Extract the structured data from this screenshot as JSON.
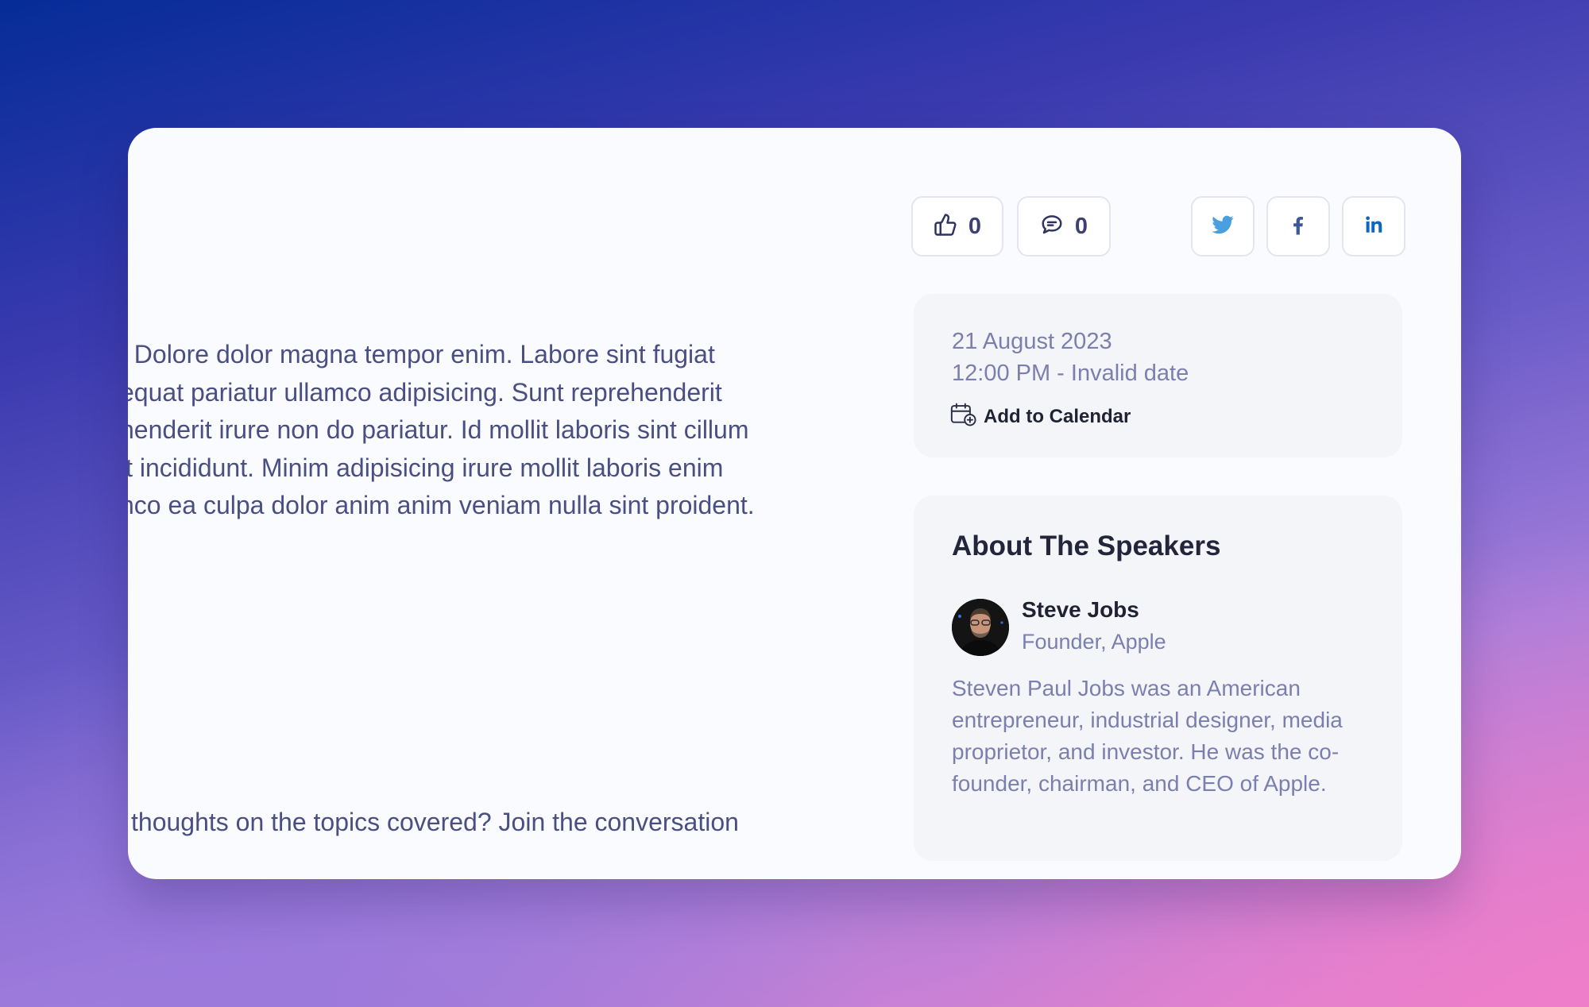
{
  "article": {
    "lines": [
      ". Dolore dolor magna tempor enim. Labore sint fugiat",
      "equat pariatur ullamco adipisicing. Sunt reprehenderit",
      "nenderit irure non do pariatur. Id mollit laboris sint cillum",
      "it incididunt. Minim adipisicing irure mollit laboris enim",
      "nco ea culpa dolor anim anim veniam nulla sint proident."
    ],
    "closing": " thoughts on the topics covered? Join the conversation"
  },
  "actions": {
    "likes": "0",
    "comments": "0"
  },
  "share": {
    "twitter_icon": "twitter-icon",
    "facebook_icon": "facebook-icon",
    "linkedin_icon": "linkedin-icon",
    "colors": {
      "twitter": "#4a9fe0",
      "facebook": "#3b5998",
      "linkedin": "#0a66c2"
    }
  },
  "event": {
    "date": "21 August 2023",
    "time": "12:00 PM - Invalid date",
    "add_to_calendar": "Add to Calendar"
  },
  "speakers": {
    "title": "About The Speakers",
    "items": [
      {
        "name": "Steve Jobs",
        "role": "Founder, Apple",
        "bio": "Steven Paul Jobs was an American entrepreneur, industrial designer, media proprietor, and investor. He was the co-founder, chairman, and CEO of Apple."
      }
    ]
  }
}
